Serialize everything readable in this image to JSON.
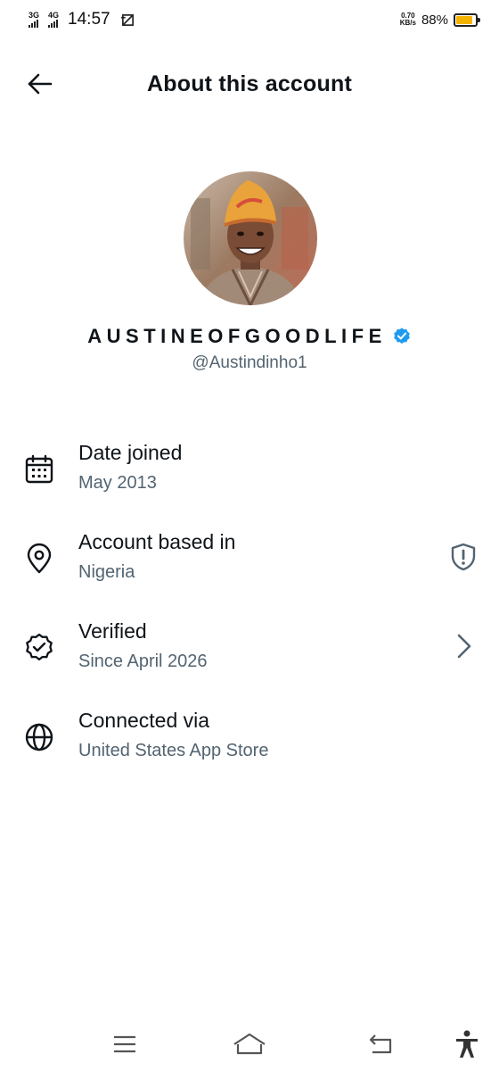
{
  "status_bar": {
    "network_1": "3G",
    "network_2": "4G",
    "time": "14:57",
    "speed_value": "0.70",
    "speed_unit": "KB/s",
    "battery_percent": "88%",
    "battery_level": 0.88,
    "battery_color": "#f5b301"
  },
  "header": {
    "title": "About this account"
  },
  "profile": {
    "display_name": "AUSTINEOFGOODLIFE",
    "handle": "@Austindinho1",
    "verified_badge_color": "#1d9bf0"
  },
  "rows": [
    {
      "icon": "calendar-icon",
      "title": "Date joined",
      "subtitle": "May 2013"
    },
    {
      "icon": "location-pin-icon",
      "title": "Account based in",
      "subtitle": "Nigeria",
      "trailing_icon": "shield-alert-icon"
    },
    {
      "icon": "verified-badge-icon",
      "title": "Verified",
      "subtitle": "Since April 2026",
      "trailing_icon": "chevron-right-icon"
    },
    {
      "icon": "globe-icon",
      "title": "Connected via",
      "subtitle": "United States App Store"
    }
  ],
  "colors": {
    "primary_text": "#0f1419",
    "secondary_text": "#536471",
    "nav_icons": "#555555"
  }
}
